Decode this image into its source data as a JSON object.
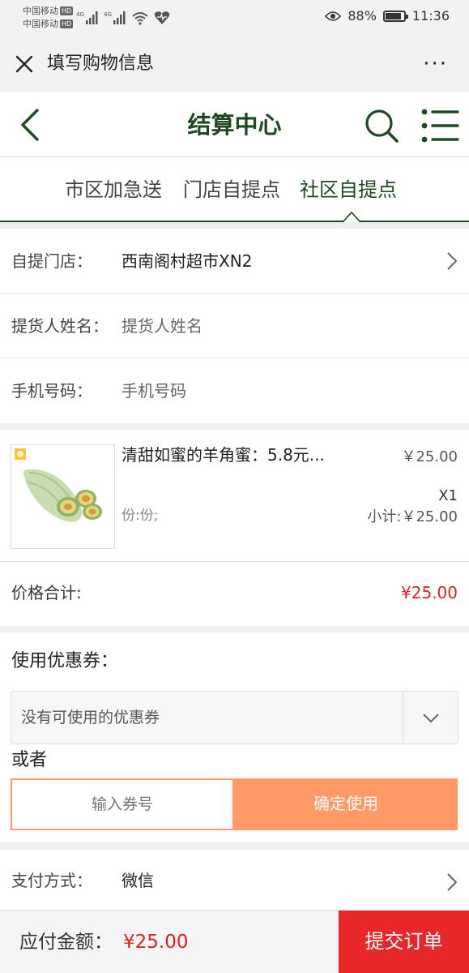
{
  "statusbar": {
    "carrier1": "中国移动",
    "carrier2": "中国移动",
    "hd": "HD",
    "network": "4G",
    "battery": "88%",
    "battery_level": 0.88,
    "time": "11:36"
  },
  "webview": {
    "title": "填写购物信息",
    "more": "···"
  },
  "header": {
    "title": "结算中心"
  },
  "tabs": [
    {
      "label": "市区加急送",
      "active": false
    },
    {
      "label": "门店自提点",
      "active": false
    },
    {
      "label": "社区自提点",
      "active": true
    }
  ],
  "form": {
    "store_label": "自提门店：",
    "store_value": "西南阁村超市XN2",
    "name_label": "提货人姓名：",
    "name_placeholder": "提货人姓名",
    "phone_label": "手机号码：",
    "phone_placeholder": "手机号码"
  },
  "product": {
    "name": "清甜如蜜的羊角蜜：5.8元...",
    "price": "￥25.00",
    "quantity": "X1",
    "spec": "份:份;",
    "subtotal": "小计:￥25.00"
  },
  "total": {
    "label": "价格合计:",
    "value": "¥25.00"
  },
  "coupon": {
    "title": "使用优惠券：",
    "select_value": "没有可使用的优惠券",
    "or_label": "或者",
    "input_placeholder": "输入券号",
    "confirm_label": "确定使用"
  },
  "payment": {
    "label": "支付方式：",
    "value": "微信"
  },
  "bottom": {
    "label": "应付金额：",
    "amount": "¥25.00",
    "submit_label": "提交订单"
  },
  "colors": {
    "brand_green": "#1d4a22",
    "price_red": "#e02020",
    "accent_orange": "#ff9966",
    "submit_red": "#e8272a"
  }
}
